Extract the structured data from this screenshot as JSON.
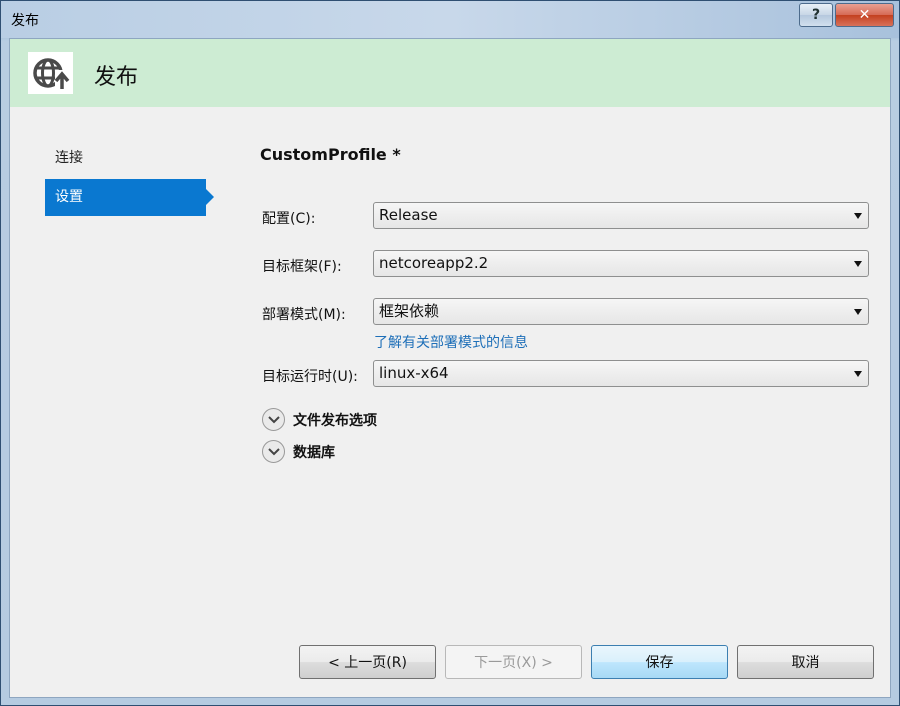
{
  "window": {
    "title": "发布"
  },
  "titlebar": {
    "help_label": "?",
    "close_label": "✕"
  },
  "header": {
    "title": "发布",
    "icon": "globe-arrow-icon"
  },
  "nav": {
    "items": [
      {
        "label": "连接"
      },
      {
        "label": "设置"
      }
    ],
    "selected": "设置"
  },
  "main": {
    "profile_name": "CustomProfile *",
    "fields": [
      {
        "label": "配置(C):",
        "value": "Release"
      },
      {
        "label": "目标框架(F):",
        "value": "netcoreapp2.2"
      },
      {
        "label": "部署模式(M):",
        "value": "框架依赖"
      },
      {
        "label": "目标运行时(U):",
        "value": "linux-x64"
      }
    ],
    "deploy_link": "了解有关部署模式的信息",
    "expanders": [
      {
        "label": "文件发布选项"
      },
      {
        "label": "数据库"
      }
    ]
  },
  "buttons": {
    "back": "< 上一页(R)",
    "next": "下一页(X) >",
    "save": "保存",
    "cancel": "取消"
  },
  "colors": {
    "header_band": "#cdecd3",
    "nav_selected": "#0a78d0",
    "link": "#1e6fb8"
  }
}
